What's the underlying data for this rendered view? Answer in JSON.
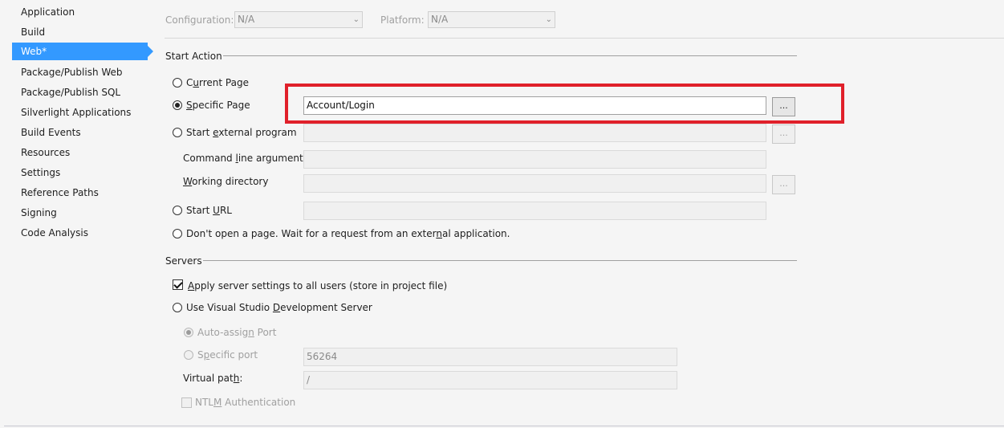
{
  "sidebar": {
    "items": [
      {
        "label": "Application"
      },
      {
        "label": "Build"
      },
      {
        "label": "Web*"
      },
      {
        "label": "Package/Publish Web"
      },
      {
        "label": "Package/Publish SQL"
      },
      {
        "label": "Silverlight Applications"
      },
      {
        "label": "Build Events"
      },
      {
        "label": "Resources"
      },
      {
        "label": "Settings"
      },
      {
        "label": "Reference Paths"
      },
      {
        "label": "Signing"
      },
      {
        "label": "Code Analysis"
      }
    ],
    "active_index": 2
  },
  "config": {
    "configuration_label": "Configuration:",
    "configuration_value": "N/A",
    "platform_label": "Platform:",
    "platform_value": "N/A"
  },
  "start_action": {
    "title": "Start Action",
    "current_page_pre": "C",
    "current_page_u": "u",
    "current_page_post": "rrent Page",
    "specific_page_pre": "",
    "specific_page_u": "S",
    "specific_page_post": "pecific Page",
    "specific_page_value": "Account/Login",
    "browse_label": "...",
    "external_pre": "Start ",
    "external_u": "e",
    "external_post": "xternal program",
    "cmd_pre": "Command ",
    "cmd_u": "l",
    "cmd_post": "ine arguments",
    "workdir_pre": "",
    "workdir_u": "W",
    "workdir_post": "orking directory",
    "start_url_pre": "Start ",
    "start_url_u": "U",
    "start_url_post": "RL",
    "dont_open_pre": "Don't open a page.  Wait for a request from an exter",
    "dont_open_u": "n",
    "dont_open_post": "al application.",
    "selected": "specific_page"
  },
  "servers": {
    "title": "Servers",
    "apply_pre": "",
    "apply_u": "A",
    "apply_post": "pply server settings to all users (store in project file)",
    "apply_checked": true,
    "vs_dev_pre": "Use Visual Studio ",
    "vs_dev_u": "D",
    "vs_dev_post": "evelopment Server",
    "auto_assign_pre": "Auto-assig",
    "auto_assign_u": "n",
    "auto_assign_post": " Port",
    "specific_port_pre": "S",
    "specific_port_u": "p",
    "specific_port_post": "ecific port",
    "specific_port_value": "56264",
    "virtual_path_pre": "Virtual pat",
    "virtual_path_u": "h",
    "virtual_path_post": ":",
    "virtual_path_value": "/",
    "ntlm_pre": "NTL",
    "ntlm_u": "M",
    "ntlm_post": " Authentication"
  }
}
